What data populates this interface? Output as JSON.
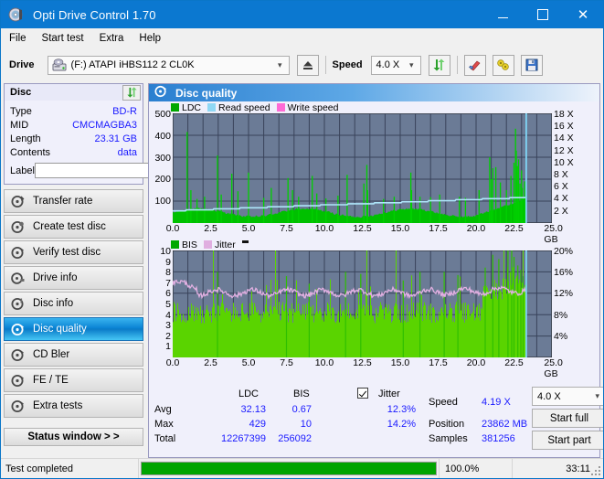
{
  "window": {
    "title": "Opti Drive Control 1.70",
    "minimize": "minimize-button",
    "maximize": "maximize-button",
    "close": "✕"
  },
  "menu": {
    "items": [
      "File",
      "Start test",
      "Extra",
      "Help"
    ]
  },
  "toolbar": {
    "drive_label": "Drive",
    "drive_value": "(F:)  ATAPI iHBS112  2 CL0K",
    "eject_title": "Eject",
    "speed_label": "Speed",
    "speed_value": "4.0 X",
    "refresh_title": "Refresh",
    "erase_title": "Erase",
    "tools_title": "Tools",
    "save_title": "Save"
  },
  "disc": {
    "header": "Disc",
    "rows": [
      {
        "key": "Type",
        "value": "BD-R"
      },
      {
        "key": "MID",
        "value": "CMCMAGBA3"
      },
      {
        "key": "Length",
        "value": "23.31 GB"
      },
      {
        "key": "Contents",
        "value": "data"
      }
    ],
    "label_key": "Label",
    "label_value": "",
    "label_placeholder": ""
  },
  "nav": {
    "items": [
      {
        "label": "Transfer rate",
        "selected": false
      },
      {
        "label": "Create test disc",
        "selected": false
      },
      {
        "label": "Verify test disc",
        "selected": false
      },
      {
        "label": "Drive info",
        "selected": false
      },
      {
        "label": "Disc info",
        "selected": false
      },
      {
        "label": "Disc quality",
        "selected": true
      },
      {
        "label": "CD Bler",
        "selected": false
      },
      {
        "label": "FE / TE",
        "selected": false
      },
      {
        "label": "Extra tests",
        "selected": false
      }
    ],
    "status_window": "Status window > >"
  },
  "panel": {
    "title": "Disc quality"
  },
  "chart_data": [
    {
      "type": "area",
      "title": "Disc quality — LDC / speed",
      "xlabel": "GB",
      "ylabel": "LDC",
      "y2label": "X",
      "xlim": [
        0,
        25
      ],
      "ylim": [
        0,
        500
      ],
      "y2lim": [
        0,
        18
      ],
      "grid": true,
      "legend_position": "top-left",
      "xticks": [
        "0.0",
        "2.5",
        "5.0",
        "7.5",
        "10.0",
        "12.5",
        "15.0",
        "17.5",
        "20.0",
        "22.5",
        "25.0 GB"
      ],
      "yticks": [
        "100",
        "200",
        "300",
        "400",
        "500"
      ],
      "y2ticks": [
        "2 X",
        "4 X",
        "6 X",
        "8 X",
        "10 X",
        "12 X",
        "14 X",
        "16 X",
        "18 X"
      ],
      "legend": [
        {
          "name": "LDC",
          "color": "#00c000"
        },
        {
          "name": "Read speed",
          "color": "#8fd8f5"
        },
        {
          "name": "Write speed",
          "color": "#ff6ad5"
        }
      ],
      "series": [
        {
          "name": "LDC",
          "color": "#00c000",
          "baseline_avg": 32.13,
          "max": 429
        },
        {
          "name": "Read speed",
          "color": "#aee6fa",
          "start": 2.0,
          "end": 4.19
        }
      ],
      "data_extent_gb": 23.31
    },
    {
      "type": "area",
      "title": "Disc quality — BIS / jitter",
      "xlabel": "GB",
      "ylabel": "BIS",
      "y2label": "%",
      "xlim": [
        0,
        25
      ],
      "ylim": [
        0,
        10
      ],
      "y2lim": [
        0,
        20
      ],
      "grid": true,
      "legend_position": "top-left",
      "xticks": [
        "0.0",
        "2.5",
        "5.0",
        "7.5",
        "10.0",
        "12.5",
        "15.0",
        "17.5",
        "20.0",
        "22.5",
        "25.0 GB"
      ],
      "yticks": [
        "1",
        "2",
        "3",
        "4",
        "5",
        "6",
        "7",
        "8",
        "9",
        "10"
      ],
      "y2ticks": [
        "4%",
        "8%",
        "12%",
        "16%",
        "20%"
      ],
      "legend": [
        {
          "name": "BIS",
          "color": "#00c000"
        },
        {
          "name": "Jitter",
          "color": "#e0aee0"
        }
      ],
      "series": [
        {
          "name": "BIS",
          "color": "#55d400",
          "baseline_avg": 0.67,
          "max": 10
        },
        {
          "name": "Jitter",
          "color": "#e2b0e2",
          "avg_pct": 12.3,
          "max_pct": 14.2
        }
      ],
      "data_extent_gb": 23.31
    }
  ],
  "stats": {
    "col_ldc": "LDC",
    "col_bis": "BIS",
    "jitter_label": "Jitter",
    "jitter_checked": true,
    "rows": [
      {
        "key": "Avg",
        "ldc": "32.13",
        "bis": "0.67",
        "jitter": "12.3%"
      },
      {
        "key": "Max",
        "ldc": "429",
        "bis": "10",
        "jitter": "14.2%"
      },
      {
        "key": "Total",
        "ldc": "12267399",
        "bis": "256092",
        "jitter": ""
      }
    ],
    "speed_label": "Speed",
    "speed_value": "4.19 X",
    "position_label": "Position",
    "position_value": "23862 MB",
    "samples_label": "Samples",
    "samples_value": "381256",
    "speed_select": "4.0 X",
    "start_full": "Start full",
    "start_part": "Start part"
  },
  "statusbar": {
    "message": "Test completed",
    "percent": "100.0%",
    "progress": 100,
    "elapsed": "33:11"
  },
  "colors": {
    "accent": "#0b78d0",
    "link_value": "#1a1aff",
    "plot_bg": "#6b7b96",
    "ldc_green": "#00c000",
    "bis_green": "#5ad400",
    "read_speed": "#aee6fa",
    "jitter": "#e2b0e2",
    "progress_green": "#00a400"
  }
}
